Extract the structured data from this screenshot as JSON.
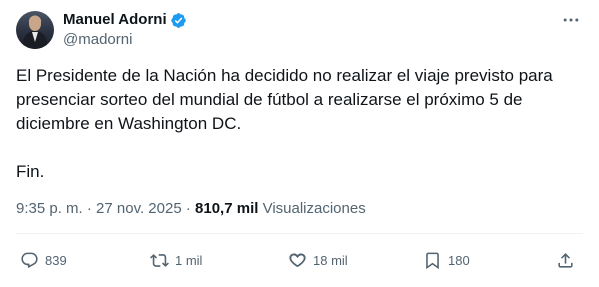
{
  "author": {
    "display_name": "Manuel Adorni",
    "handle": "@madorni",
    "verified": true
  },
  "tweet": {
    "text": "El Presidente de la Nación ha decidido no realizar el viaje previsto para presenciar sorteo del mundial de fútbol a realizarse el próximo 5 de diciembre en Washington DC.\n\nFin.",
    "time": "9:35 p. m.",
    "separator": " · ",
    "date": "27 nov. 2025",
    "views_count": "810,7 mil",
    "views_label": " Visualizaciones"
  },
  "actions": {
    "replies": "839",
    "retweets": "1 mil",
    "likes": "18 mil",
    "bookmarks": "180"
  },
  "icons": {
    "verified": "verified-badge-icon",
    "more": "more-icon",
    "reply": "reply-icon",
    "retweet": "retweet-icon",
    "like": "heart-icon",
    "bookmark": "bookmark-icon",
    "share": "share-icon"
  },
  "colors": {
    "verified_blue": "#1d9bf0",
    "secondary_text": "#536471",
    "primary_text": "#0f1419"
  }
}
